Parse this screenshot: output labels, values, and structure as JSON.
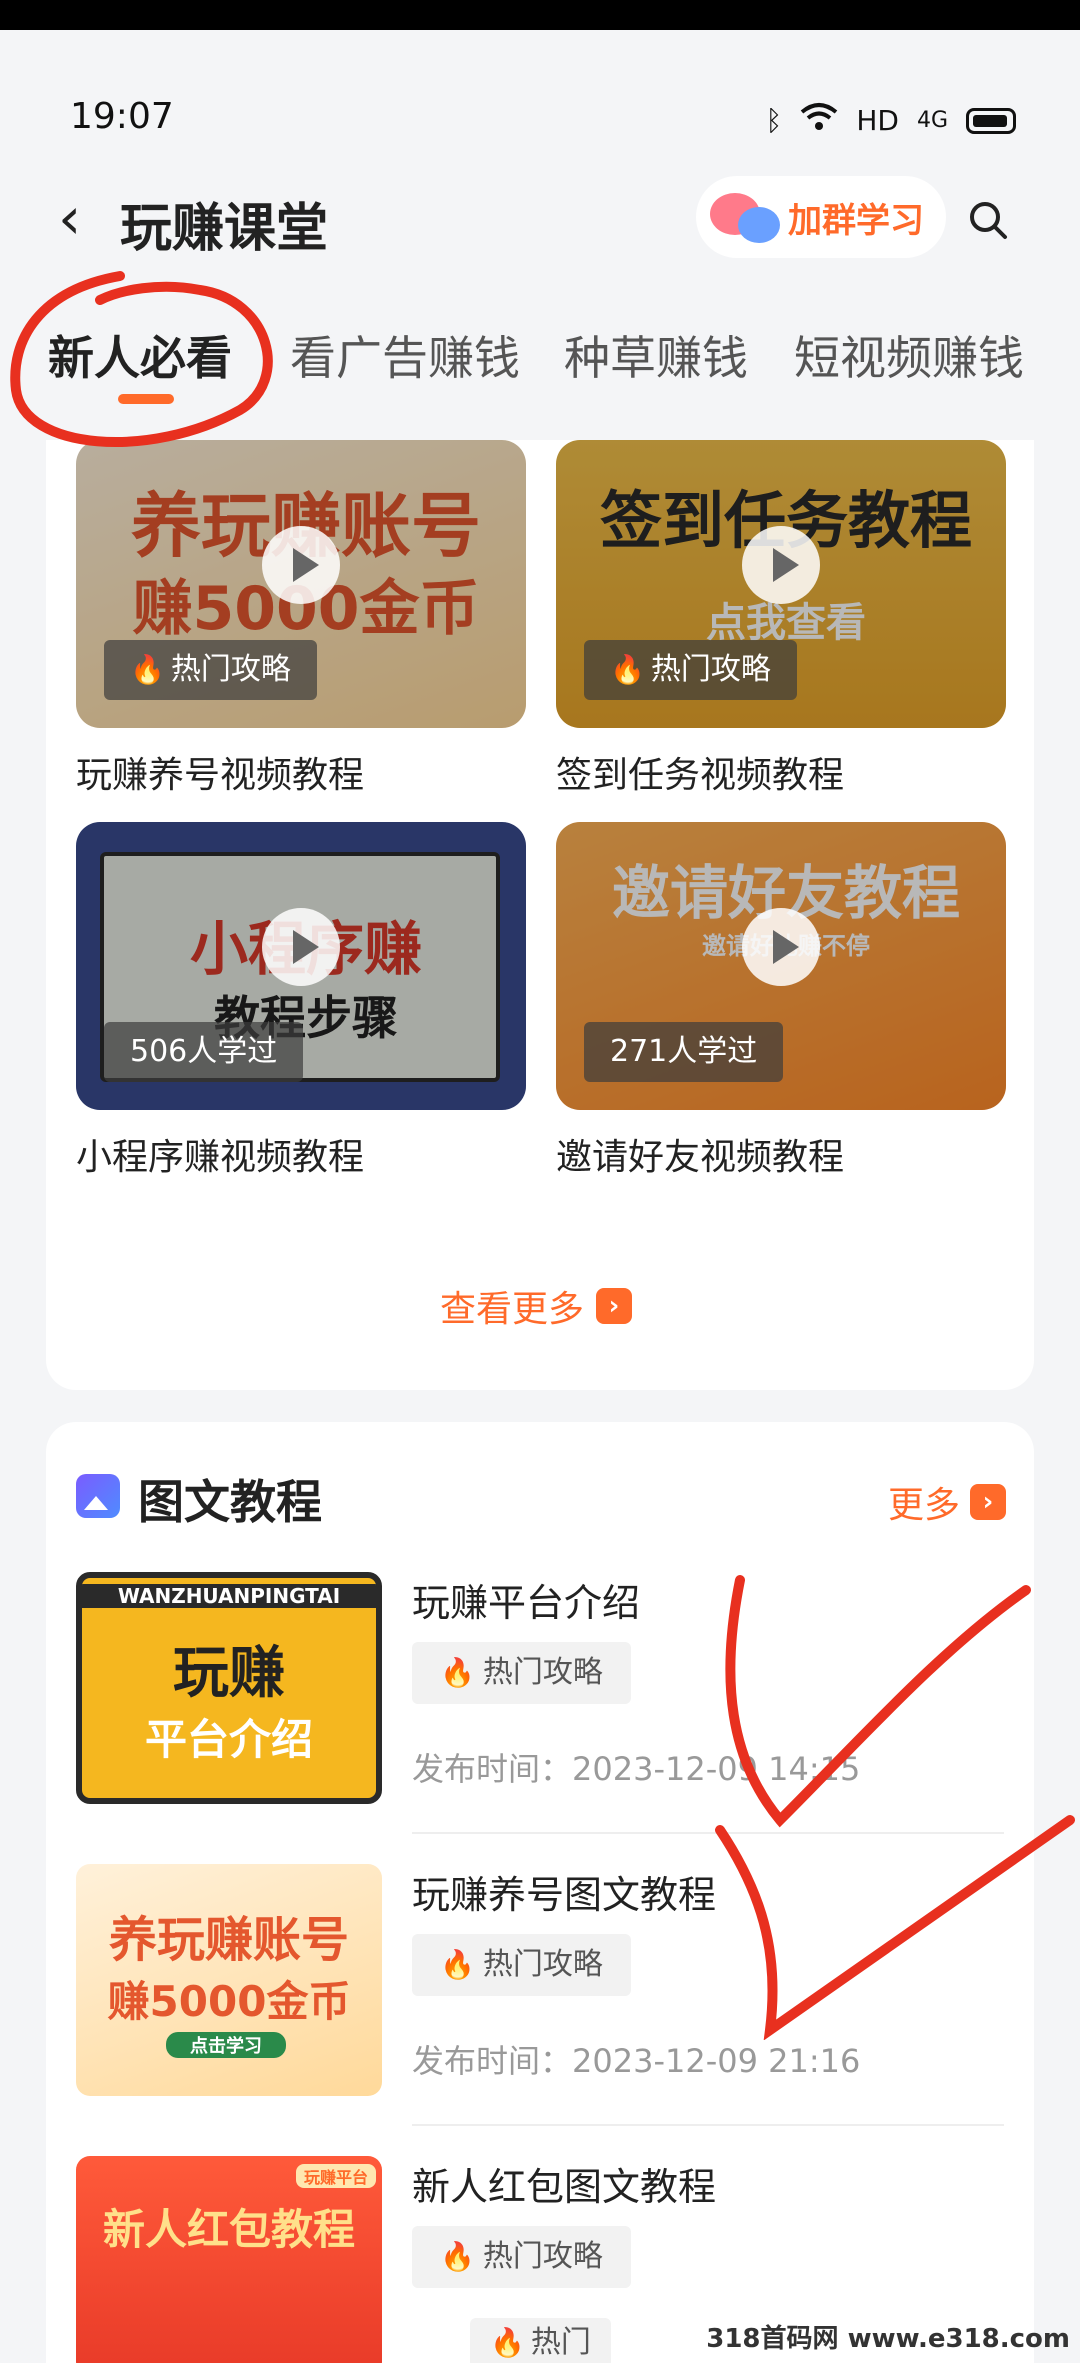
{
  "status_bar": {
    "time": "19:07",
    "network": "HD",
    "signal": "4G"
  },
  "header": {
    "title": "玩赚课堂",
    "group_button": "加群学习"
  },
  "tabs": [
    {
      "label": "新人必看"
    },
    {
      "label": "看广告赚钱"
    },
    {
      "label": "种草赚钱"
    },
    {
      "label": "短视频赚钱"
    }
  ],
  "videos": [
    {
      "thumb_text": "养玩赚账号",
      "thumb_sub": "赚5000金币",
      "badge": "热门攻略",
      "title": "玩赚养号视频教程"
    },
    {
      "thumb_text": "签到任务教程",
      "thumb_sub": "点我查看",
      "badge": "热门攻略",
      "title": "签到任务视频教程"
    },
    {
      "thumb_text": "小程序赚",
      "thumb_sub": "教程步骤",
      "badge": "506人学过",
      "title": "小程序赚视频教程"
    },
    {
      "thumb_text": "邀请好友教程",
      "thumb_sub": "邀请好礼赚不停",
      "badge": "271人学过",
      "title": "邀请好友视频教程"
    }
  ],
  "more_link": "查看更多",
  "articles_section": {
    "title": "图文教程",
    "more": "更多",
    "items": [
      {
        "thumb_text": "玩赚",
        "thumb_sub": "平台介绍",
        "thumb_band": "WANZHUANPINGTAI",
        "title": "玩赚平台介绍",
        "tag": "热门攻略",
        "published": "发布时间：2023-12-09 14:15"
      },
      {
        "thumb_text": "养玩赚账号",
        "thumb_sub": "赚5000金币",
        "thumb_band": "点击学习",
        "title": "玩赚养号图文教程",
        "tag": "热门攻略",
        "published": "发布时间：2023-12-09 21:16"
      },
      {
        "thumb_text": "新人红包教程",
        "thumb_sub": "",
        "thumb_band": "玩赚平台",
        "title": "新人红包图文教程",
        "tag": "热门攻略",
        "published": ""
      }
    ]
  },
  "floating_tag": "热门",
  "watermark": "318首码网 www.e318.com",
  "colors": {
    "accent": "#ff6a2a",
    "background": "#f4f5f7",
    "annotation": "#e8301f"
  }
}
